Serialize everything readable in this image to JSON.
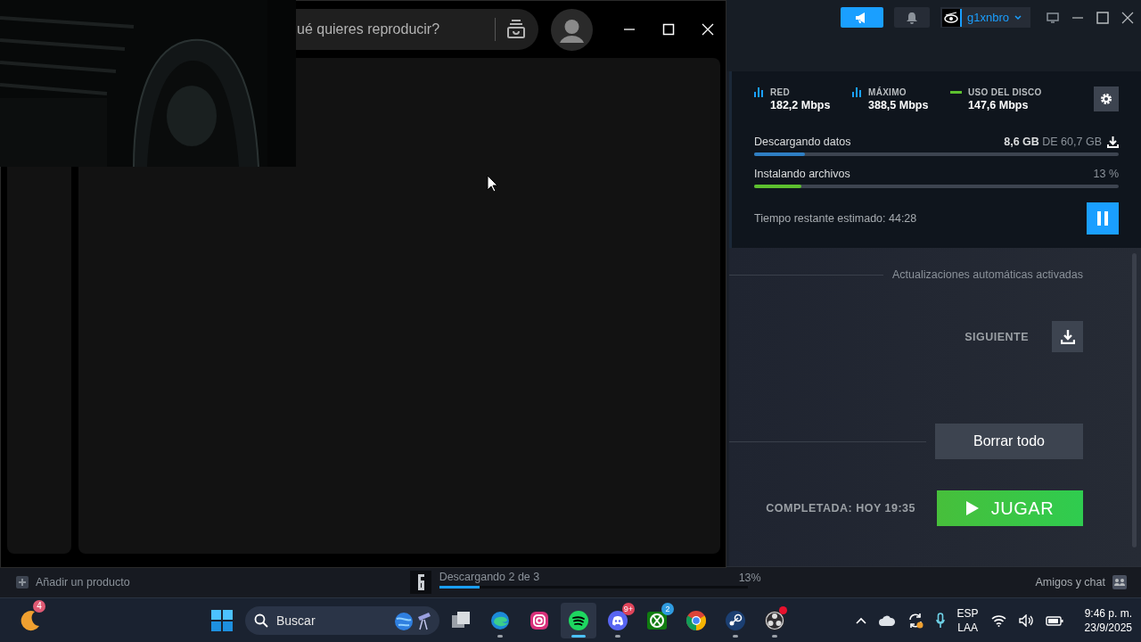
{
  "steam": {
    "user": "g1xnbro",
    "stats": [
      {
        "kind": "bars",
        "label": "RED",
        "value": "182,2 Mbps"
      },
      {
        "kind": "bars",
        "label": "MÁXIMO",
        "value": "388,5 Mbps"
      },
      {
        "kind": "line",
        "label": "USO DEL DISCO",
        "value": "147,6 Mbps"
      }
    ],
    "downloading": {
      "label": "Descargando datos",
      "reading": "**8,6 GB** DE 60,7 GB",
      "level": 0.14
    },
    "installing": {
      "label": "Instalando archivos",
      "reading": "13 %",
      "level": 0.13
    },
    "time_left": "Tiempo restante estimado: 44:28",
    "auto_updates": "Actualizaciones automáticas activadas",
    "next_label": "SIGUIENTE",
    "clear_button": "Borrar todo",
    "completed": "COMPLETADA: HOY 19:35",
    "play_button": "JUGAR",
    "bottom_bar": {
      "add_product": "Añadir un producto",
      "download_status": "Descargando 2 de 3",
      "level": 0.13,
      "reading": "13%",
      "friends": "Amigos y chat"
    }
  },
  "spotify": {
    "search": {
      "placeholder": "ué quieres reproducir?"
    }
  },
  "taskbar": {
    "weather_badge": "4",
    "search": {
      "placeholder": "Buscar"
    },
    "apps": [
      {
        "kind": "tasks",
        "running": false,
        "selected": false,
        "alert": false
      },
      {
        "kind": "edge",
        "running": true,
        "selected": false,
        "alert": false
      },
      {
        "kind": "instagram",
        "running": false,
        "selected": false,
        "alert": false
      },
      {
        "kind": "spotify",
        "running": true,
        "selected": true,
        "alert": false
      },
      {
        "kind": "discord",
        "running": true,
        "selected": false,
        "alert": false,
        "badge": "9+"
      },
      {
        "kind": "xbox",
        "running": false,
        "selected": false,
        "alert": false,
        "badge": "2"
      },
      {
        "kind": "chrome",
        "running": false,
        "selected": false,
        "alert": false
      },
      {
        "kind": "steam",
        "running": true,
        "selected": false,
        "alert": false
      },
      {
        "kind": "obs",
        "running": true,
        "selected": false,
        "alert": true
      }
    ],
    "tray": {
      "language": "ESP",
      "layout": "LAA",
      "time": "9:46 p. m.",
      "date": "23/9/2025"
    }
  }
}
